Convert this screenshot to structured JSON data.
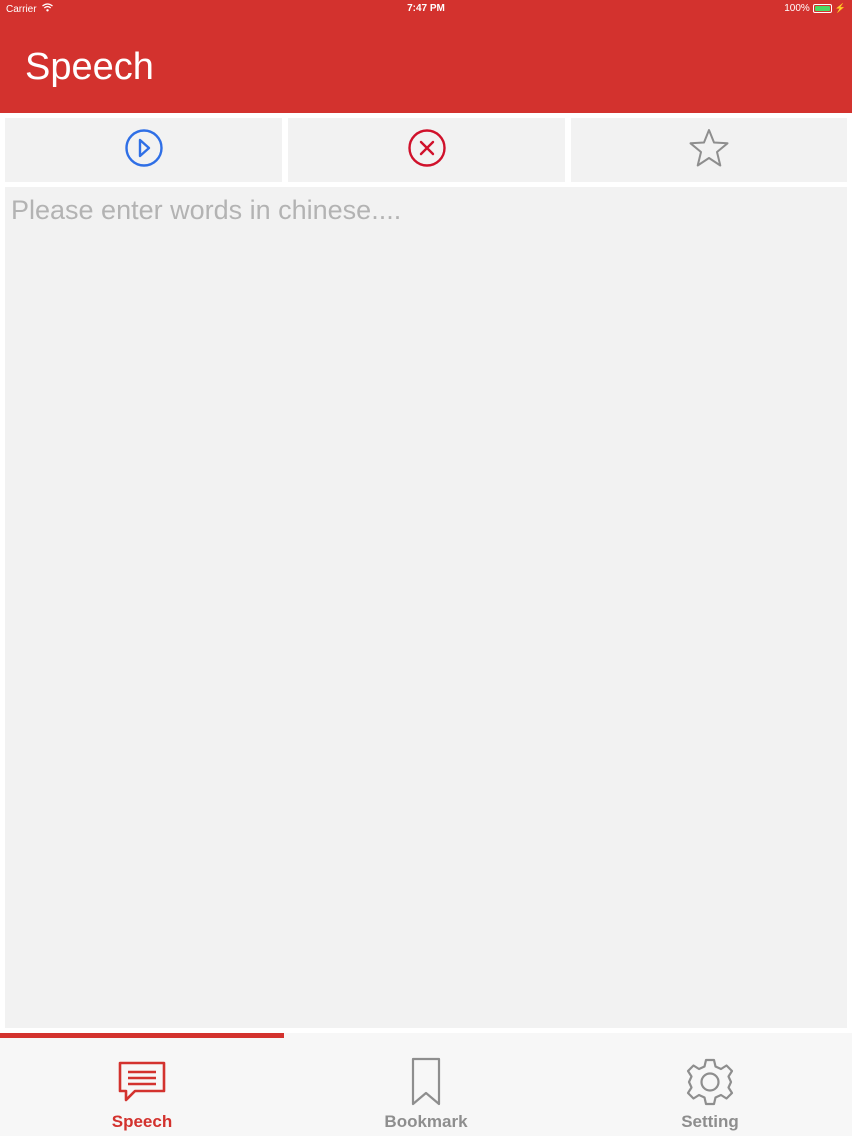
{
  "status_bar": {
    "carrier": "Carrier",
    "time": "7:47 PM",
    "battery": "100%"
  },
  "nav": {
    "title": "Speech"
  },
  "toolbar": {
    "play_icon": "play-circle-icon",
    "clear_icon": "close-circle-icon",
    "favorite_icon": "star-icon"
  },
  "input": {
    "placeholder": "Please enter words in chinese....",
    "value": ""
  },
  "tabs": [
    {
      "label": "Speech",
      "icon": "speech-bubble-icon",
      "active": true
    },
    {
      "label": "Bookmark",
      "icon": "bookmark-icon",
      "active": false
    },
    {
      "label": "Setting",
      "icon": "gear-icon",
      "active": false
    }
  ],
  "colors": {
    "accent": "#d3322e",
    "play": "#2f6fe6",
    "clear": "#d0112b",
    "inactive": "#8e8e8e"
  }
}
